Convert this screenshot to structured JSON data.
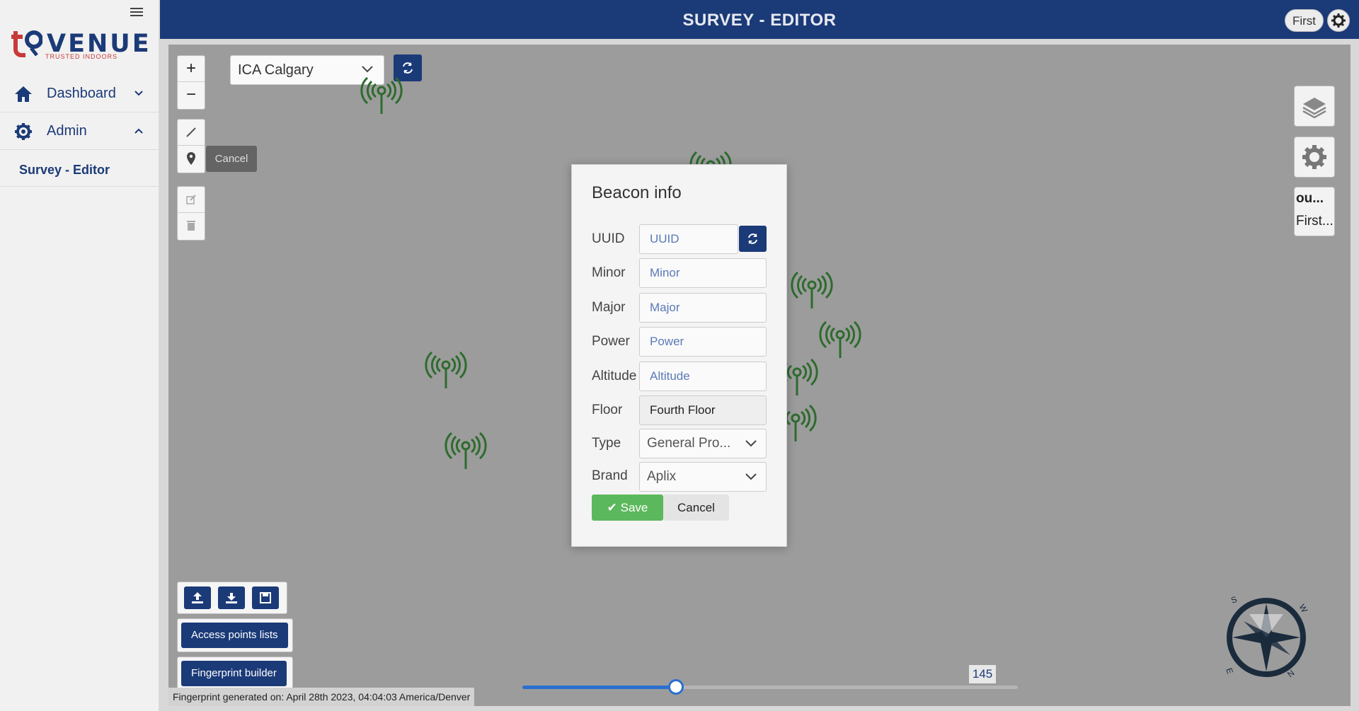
{
  "app": {
    "logo_text": "VENUE",
    "logo_tagline": "TRUSTED INDOORS",
    "title": "SURVEY - EDITOR",
    "user_label": "First"
  },
  "sidebar": {
    "items": [
      {
        "label": "Dashboard",
        "icon": "home-icon"
      },
      {
        "label": "Admin",
        "icon": "gear-icon"
      }
    ],
    "sub_item": "Survey - Editor"
  },
  "map": {
    "venue_selected": "ICA Calgary",
    "cancel_tooltip": "Cancel",
    "layers": [
      "ou...",
      "First..."
    ],
    "buttons": {
      "access_points": "Access points lists",
      "fingerprint": "Fingerprint builder"
    },
    "fingerprint_status": "Fingerprint generated on: April 28th 2023, 04:04:03 America/Denver",
    "slider_value": "145",
    "slider_fraction": 0.31,
    "compass_letters": [
      "S",
      "W",
      "N",
      "E"
    ]
  },
  "modal": {
    "title": "Beacon info",
    "fields": {
      "uuid": {
        "label": "UUID",
        "placeholder": "UUID"
      },
      "minor": {
        "label": "Minor",
        "placeholder": "Minor"
      },
      "major": {
        "label": "Major",
        "placeholder": "Major"
      },
      "power": {
        "label": "Power",
        "placeholder": "Power"
      },
      "altitude": {
        "label": "Altitude",
        "placeholder": "Altitude"
      },
      "floor": {
        "label": "Floor",
        "value": "Fourth Floor"
      },
      "type": {
        "label": "Type",
        "value": "General Pro..."
      },
      "brand": {
        "label": "Brand",
        "value": "Aplix"
      }
    },
    "save_label": "Save",
    "cancel_label": "Cancel"
  },
  "colors": {
    "primary": "#1b3a78",
    "success": "#5cb85c",
    "beacon": "#2e6b2e",
    "slider": "#2a6fd0"
  }
}
